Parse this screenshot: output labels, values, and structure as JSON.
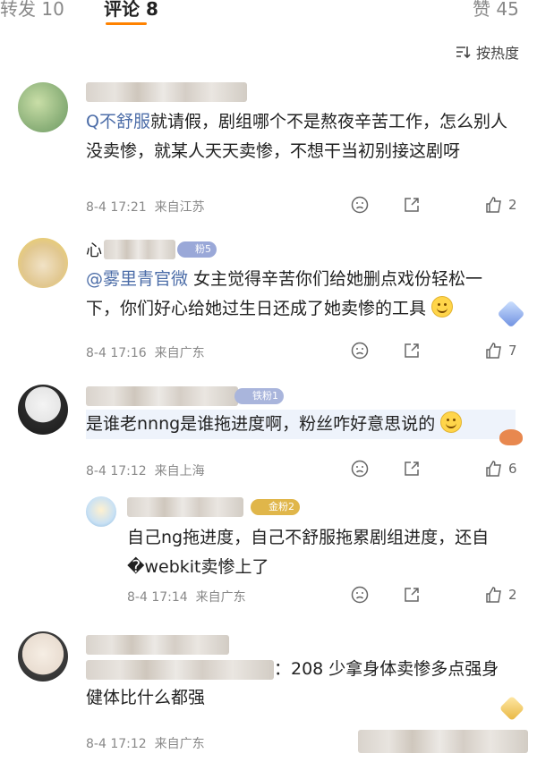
{
  "tabs": {
    "repost": "转发 10",
    "comment": "评论 8",
    "like": "赞 45"
  },
  "sort": {
    "label": "按热度"
  },
  "comments": [
    {
      "mention": "Q不舒服",
      "text_after": "就请假，剧组哪个不是熬夜辛苦工作，怎么别人没卖惨，就某人天天卖惨，不想干当初别接这剧呀",
      "time": "8-4 17:21",
      "location": "来自江苏",
      "likes": "2"
    },
    {
      "badge": "粉5",
      "mention": "@雾里青官微",
      "text_after": " 女主觉得辛苦你们给她删点戏份轻松一下，你们好心给她过生日还成了她卖惨的工具",
      "time": "8-4 17:16",
      "location": "来自广东",
      "likes": "7"
    },
    {
      "badge": "铁粉1",
      "text": "是谁老nnng是谁拖进度啊，粉丝咋好意思说的",
      "time": "8-4 17:12",
      "location": "来自上海",
      "likes": "6"
    },
    {
      "badge": "金粉2",
      "text": "自己ng拖进度，自己不舒服拖累剧组进度，还自�webkit卖惨上了",
      "time": "8-4 17:14",
      "location": "来自广东",
      "likes": "2"
    },
    {
      "text_line1": "：208 少拿身体卖惨多点强身",
      "text_line2": "健体比什么都强",
      "time": "8-4 17:12",
      "location": "来自广东"
    }
  ],
  "colors": {
    "accent": "#ff8200",
    "mention": "#4c6da8",
    "meta": "#888888"
  }
}
